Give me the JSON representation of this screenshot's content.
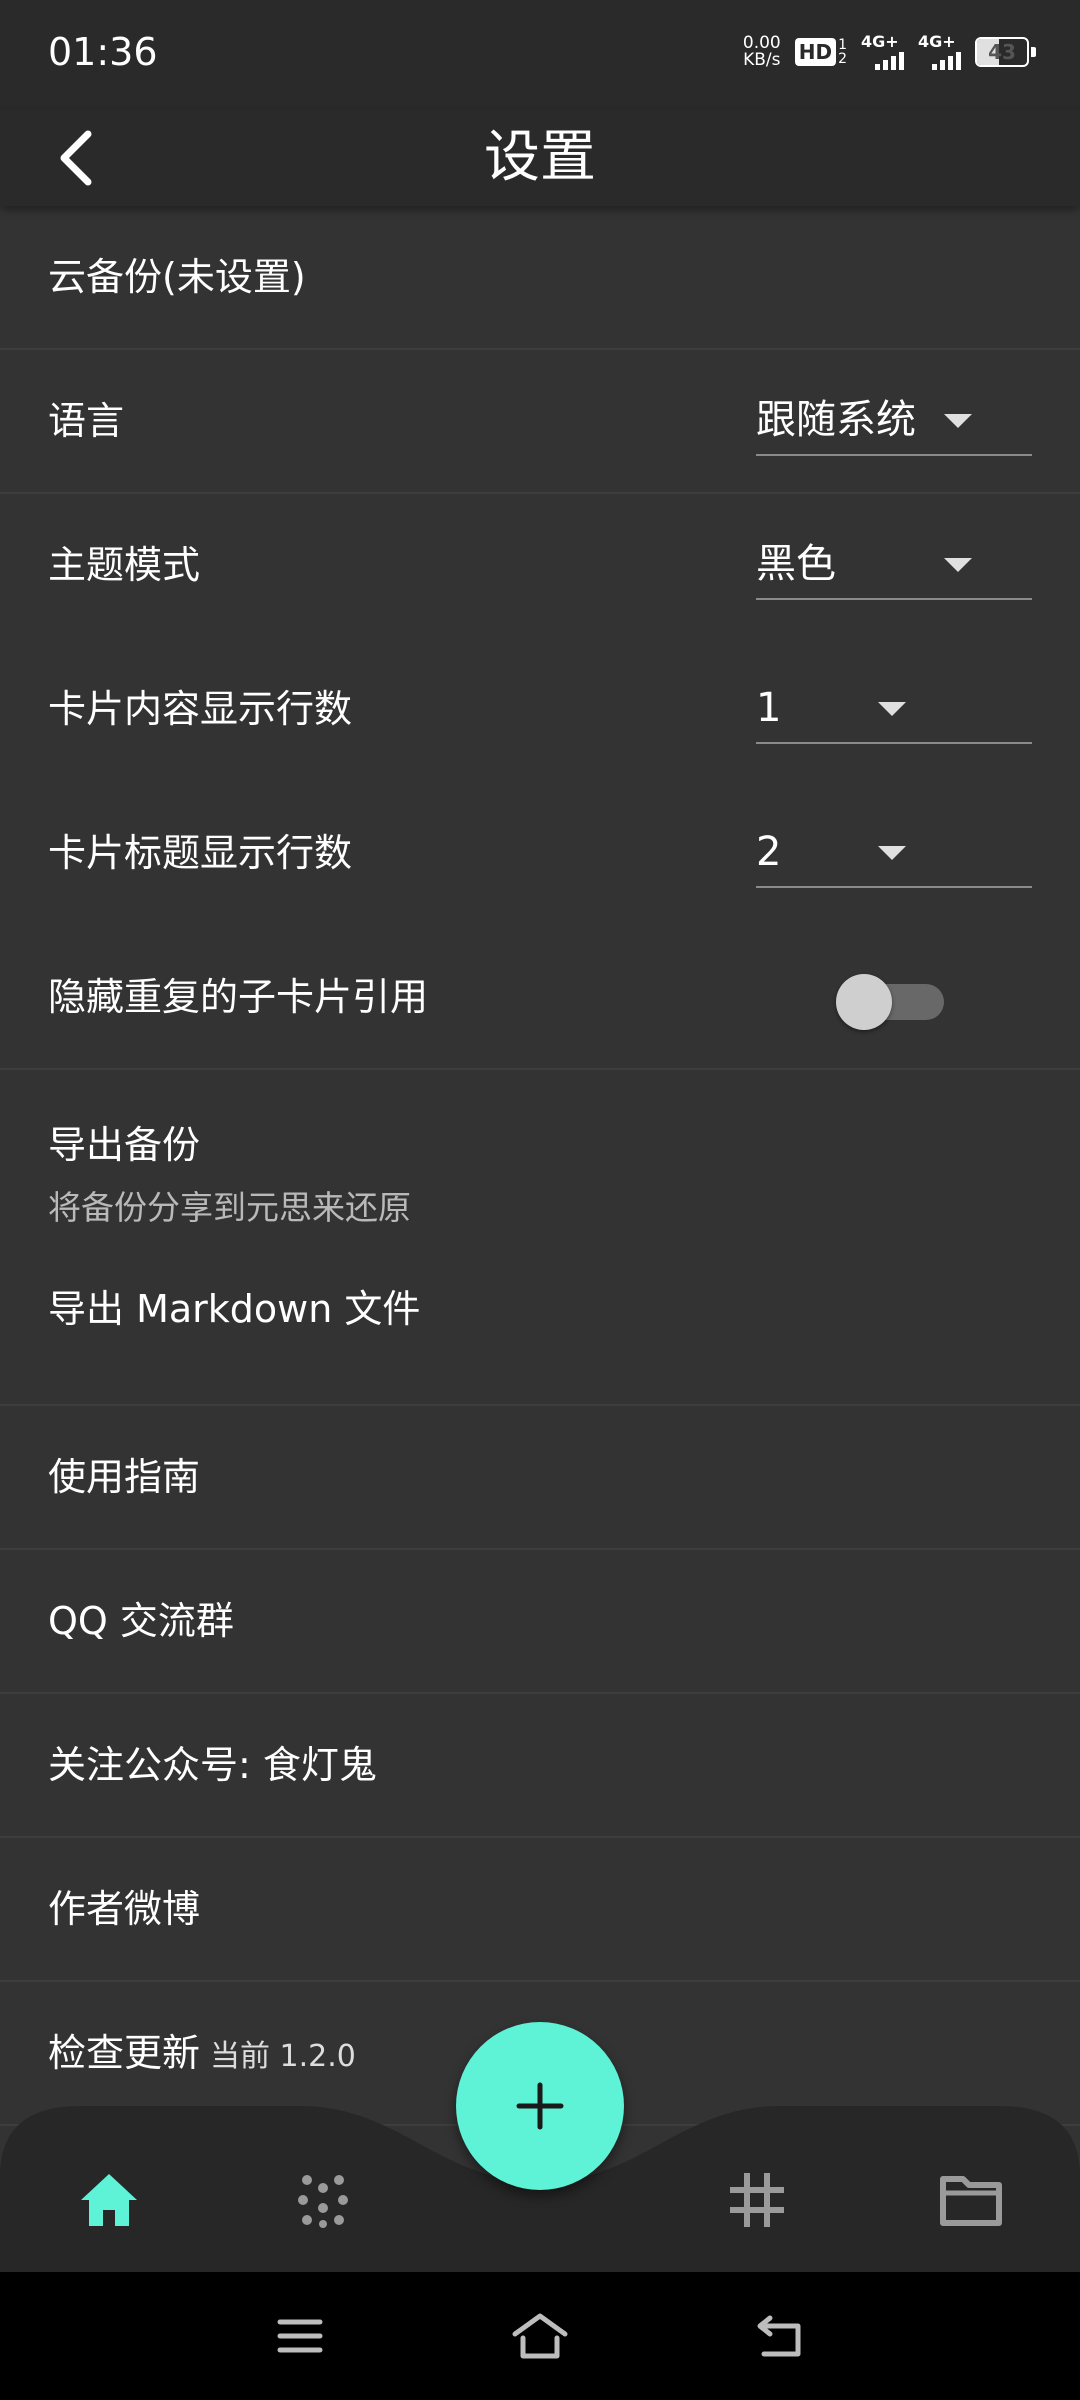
{
  "status": {
    "time": "01:36",
    "net_speed_value": "0.00",
    "net_speed_unit": "KB/s",
    "hd_label": "HD",
    "hd_sub": "1\n2",
    "sim1": "4G+",
    "sim2": "4G+",
    "battery": "43"
  },
  "header": {
    "title": "设置",
    "back_icon": "chevron-left-icon"
  },
  "settings": {
    "cloud_backup": "云备份(未设置)",
    "language_label": "语言",
    "language_value": "跟随系统",
    "theme_label": "主题模式",
    "theme_value": "黑色",
    "content_lines_label": "卡片内容显示行数",
    "content_lines_value": "1",
    "title_lines_label": "卡片标题显示行数",
    "title_lines_value": "2",
    "hide_duplicate_label": "隐藏重复的子卡片引用",
    "hide_duplicate_on": false,
    "export_backup_label": "导出备份",
    "export_backup_sub": "将备份分享到元思来还原",
    "export_markdown": "导出 Markdown 文件",
    "guide": "使用指南",
    "qq_group": "QQ 交流群",
    "wechat": "关注公众号: 食灯鬼",
    "weibo": "作者微博",
    "check_update": "检查更新",
    "current_version": "当前 1.2.0"
  },
  "bottom_nav": {
    "items": [
      "home-icon",
      "dots-grid-icon",
      "hash-icon",
      "folder-icon"
    ],
    "active": "home-icon",
    "fab_icon": "plus-icon"
  },
  "colors": {
    "accent": "#5ef2d6",
    "background": "#333333",
    "bar": "#2a2a2a"
  }
}
